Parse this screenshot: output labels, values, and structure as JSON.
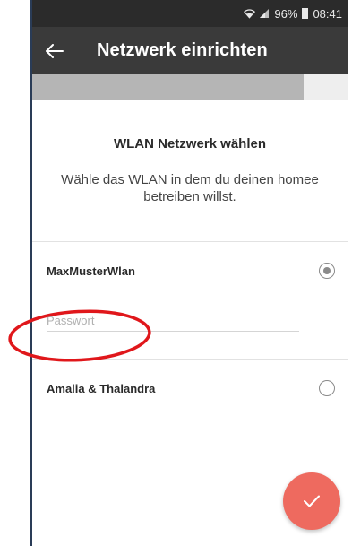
{
  "status_bar": {
    "battery": "96%",
    "time": "08:41"
  },
  "app_bar": {
    "title": "Netzwerk einrichten",
    "back_icon": "arrow-left-icon"
  },
  "progress": {
    "fraction": 0.86
  },
  "main": {
    "heading": "WLAN Netzwerk wählen",
    "subtitle": "Wähle das WLAN in dem du deinen homee betreiben willst."
  },
  "networks": [
    {
      "name": "MaxMusterWlan",
      "selected": true
    },
    {
      "name": "Amalia & Thalandra",
      "selected": false
    }
  ],
  "password": {
    "placeholder": "Passwort",
    "value": ""
  },
  "fab": {
    "icon": "checkmark-icon",
    "color": "#ee6a5f"
  },
  "annotation": {
    "color": "#e0171b"
  }
}
